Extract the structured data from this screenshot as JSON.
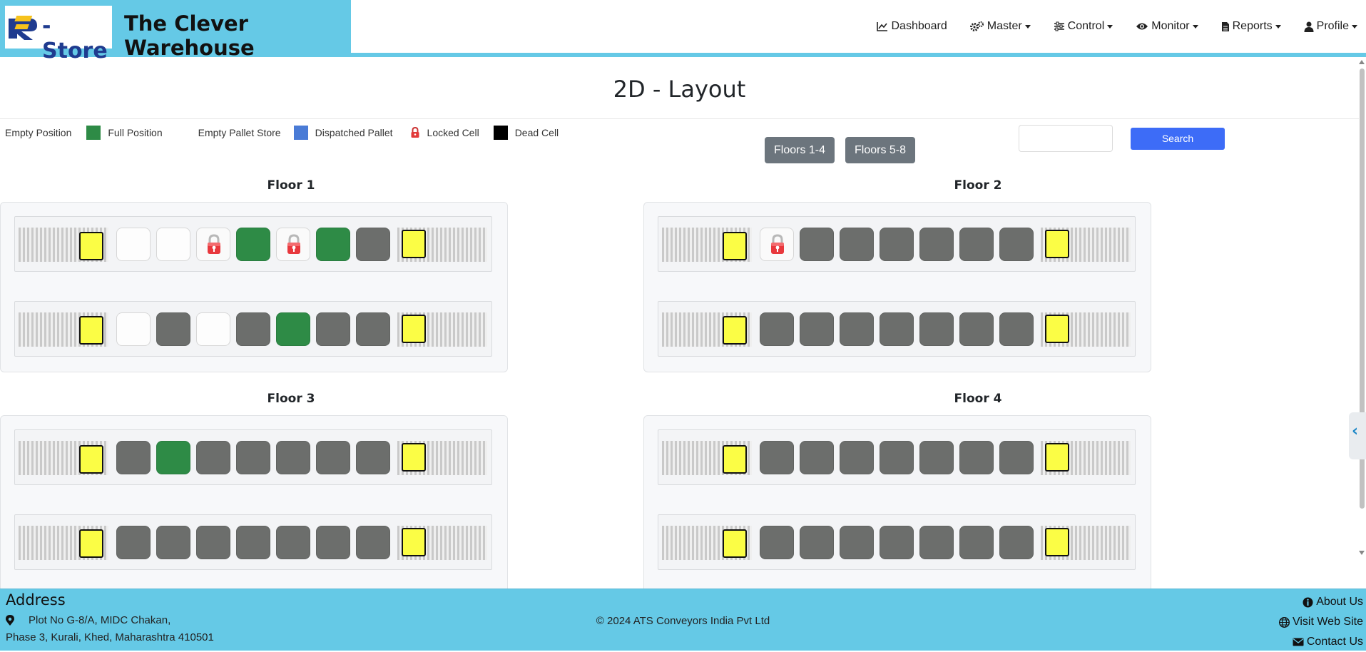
{
  "header": {
    "logo_text": "-Store",
    "brand_title": "The Clever Warehouse",
    "nav": [
      {
        "label": "Dashboard",
        "icon": "chart-line-icon",
        "dropdown": false
      },
      {
        "label": "Master",
        "icon": "gears-icon",
        "dropdown": true
      },
      {
        "label": "Control",
        "icon": "sliders-icon",
        "dropdown": true
      },
      {
        "label": "Monitor",
        "icon": "eye-icon",
        "dropdown": true
      },
      {
        "label": "Reports",
        "icon": "file-icon",
        "dropdown": true
      },
      {
        "label": "Profile",
        "icon": "user-icon",
        "dropdown": true
      }
    ]
  },
  "page": {
    "title": "2D - Layout"
  },
  "legend": [
    {
      "label": "Empty Position",
      "color": "#ffffff"
    },
    {
      "label": "Full Position",
      "color": "#2e8b46"
    },
    {
      "label": "Empty Pallet Store",
      "color": "#ffffff"
    },
    {
      "label": "Dispatched Pallet",
      "color": "#4a7bd6"
    },
    {
      "label": "Locked Cell",
      "icon": "lock-icon"
    },
    {
      "label": "Dead Cell",
      "color": "#000000"
    }
  ],
  "floor_buttons": [
    "Floors 1-4",
    "Floors 5-8"
  ],
  "search": {
    "placeholder": "",
    "button_label": "Search"
  },
  "colors": {
    "header_accent": "#65c9e6",
    "full": "#2e8b46",
    "store": "#6c6e6c",
    "pallet": "#fbfd45",
    "search_button": "#3d6cf7"
  },
  "floors": [
    {
      "label": "Floor 1",
      "rows": [
        [
          "empty",
          "empty",
          "locked",
          "full",
          "locked",
          "full",
          "store"
        ],
        [
          "empty",
          "store",
          "empty",
          "store",
          "full",
          "store",
          "store"
        ]
      ]
    },
    {
      "label": "Floor 2",
      "rows": [
        [
          "locked",
          "store",
          "store",
          "store",
          "store",
          "store",
          "store"
        ],
        [
          "store",
          "store",
          "store",
          "store",
          "store",
          "store",
          "store"
        ]
      ]
    },
    {
      "label": "Floor 3",
      "rows": [
        [
          "store",
          "full",
          "store",
          "store",
          "store",
          "store",
          "store"
        ],
        [
          "store",
          "store",
          "store",
          "store",
          "store",
          "store",
          "store"
        ]
      ]
    },
    {
      "label": "Floor 4",
      "rows": [
        [
          "store",
          "store",
          "store",
          "store",
          "store",
          "store",
          "store"
        ],
        [
          "store",
          "store",
          "store",
          "store",
          "store",
          "store",
          "store"
        ]
      ]
    }
  ],
  "footer": {
    "address_title": "Address",
    "address_line1": "Plot No G-8/A, MIDC Chakan,",
    "address_line2": "Phase 3, Kurali, Khed, Maharashtra 410501",
    "copyright": "© 2024 ATS Conveyors India Pvt Ltd",
    "links": [
      {
        "label": "About Us",
        "icon": "info-circle-icon"
      },
      {
        "label": "Visit Web Site",
        "icon": "globe-icon"
      },
      {
        "label": "Contact Us",
        "icon": "envelope-icon"
      }
    ]
  }
}
